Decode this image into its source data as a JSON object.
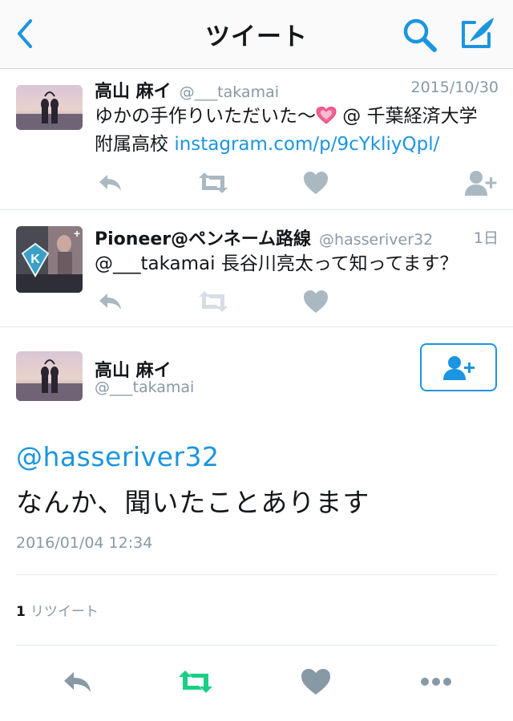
{
  "nav": {
    "title": "ツイート"
  },
  "tweets": [
    {
      "name": "高山 麻イ",
      "handle": "@___takamai",
      "time": "2015/10/30",
      "line1": "ゆかの手作りいただいた〜",
      "line1_after": " @ 千葉経済大学",
      "line2_text": "附属高校 ",
      "line2_link": "instagram.com/p/9cYkliyQpl/"
    },
    {
      "name": "Pioneer@ペンネーム路線",
      "handle": "@hasseriver32",
      "time": "1日",
      "text": "@___takamai 長谷川亮太って知ってます？"
    }
  ],
  "detail": {
    "name": "高山 麻イ",
    "handle": "@___takamai",
    "mention": "@hasseriver32",
    "text": "なんか、聞いたことあります",
    "timestamp": "2016/01/04 12:34",
    "retweet_count": "1",
    "retweet_label": "リツイート"
  },
  "colors": {
    "accent": "#1b95e0",
    "retweet_active": "#19cf86",
    "icon_gray": "#aab8c2",
    "muted_text": "#8899a6"
  },
  "icons": [
    "back-icon",
    "search-icon",
    "compose-icon",
    "reply-icon",
    "retweet-icon",
    "like-icon",
    "follow-icon",
    "more-icon"
  ]
}
